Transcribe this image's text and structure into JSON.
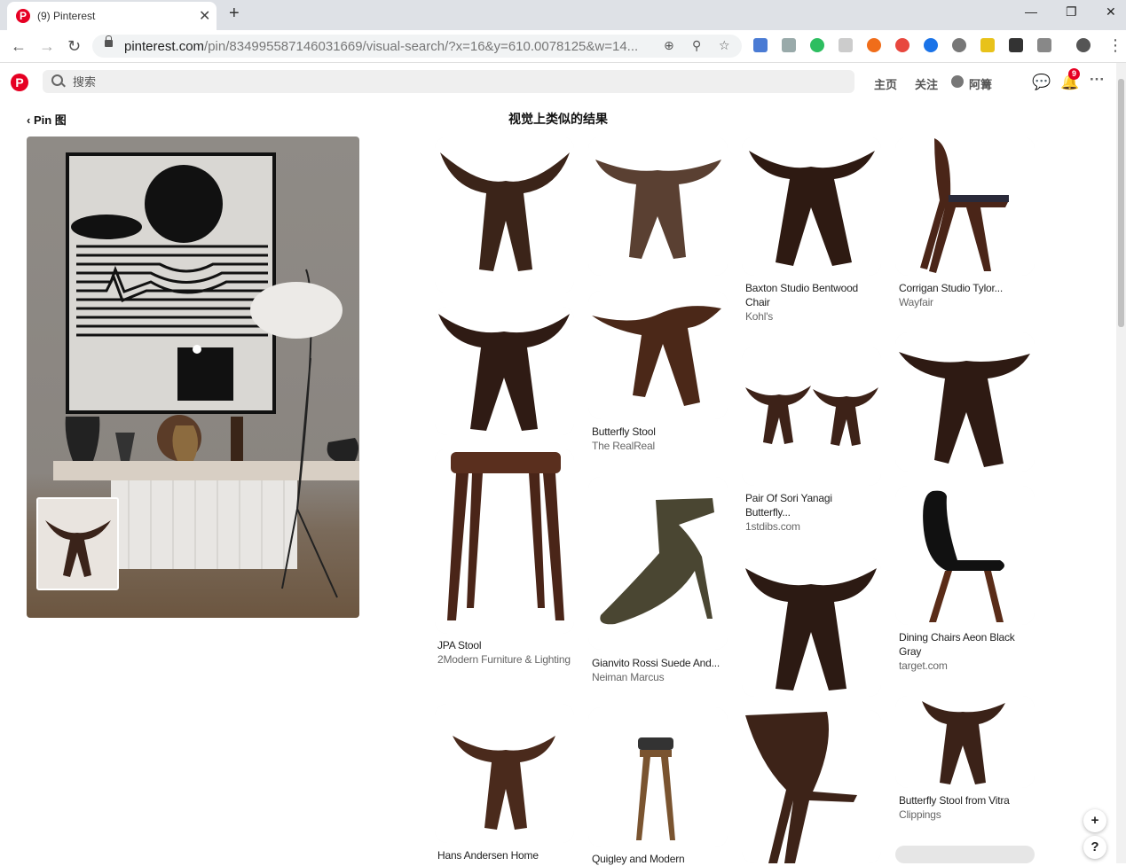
{
  "browser": {
    "tab_title": "(9) Pinterest",
    "url_host": "pinterest.com",
    "url_path": "/pin/834995587146031669/visual-search/?x=16&y=610.0078125&w=14..."
  },
  "header": {
    "search_placeholder": "搜索",
    "nav_home": "主页",
    "nav_following": "关注",
    "nav_profile": "阿篝",
    "notifications_count": "9"
  },
  "left": {
    "back_label": "Pin 图"
  },
  "main": {
    "title": "视觉上类似的结果",
    "pins": [
      {
        "title": "",
        "source": ""
      },
      {
        "title": "",
        "source": ""
      },
      {
        "title": "Baxton Studio Bentwood Chair",
        "source": "Kohl's"
      },
      {
        "title": "Corrigan Studio Tylor...",
        "source": "Wayfair"
      },
      {
        "title": "",
        "source": ""
      },
      {
        "title": "Butterfly Stool",
        "source": "The RealReal"
      },
      {
        "title": "Pair Of Sori Yanagi Butterfly...",
        "source": "1stdibs.com"
      },
      {
        "title": "",
        "source": ""
      },
      {
        "title": "JPA Stool",
        "source": "2Modern Furniture & Lighting"
      },
      {
        "title": "Gianvito Rossi Suede And...",
        "source": "Neiman Marcus"
      },
      {
        "title": "",
        "source": ""
      },
      {
        "title": "Dining Chairs Aeon Black Gray",
        "source": "target.com"
      },
      {
        "title": "Butterfly Stool from Vitra",
        "source": "Clippings"
      },
      {
        "title": "Hans Andersen Home",
        "source": ""
      },
      {
        "title": "Quigley and Modern",
        "source": ""
      },
      {
        "title": "",
        "source": ""
      }
    ]
  },
  "float": {
    "plus": "+",
    "help": "?"
  }
}
